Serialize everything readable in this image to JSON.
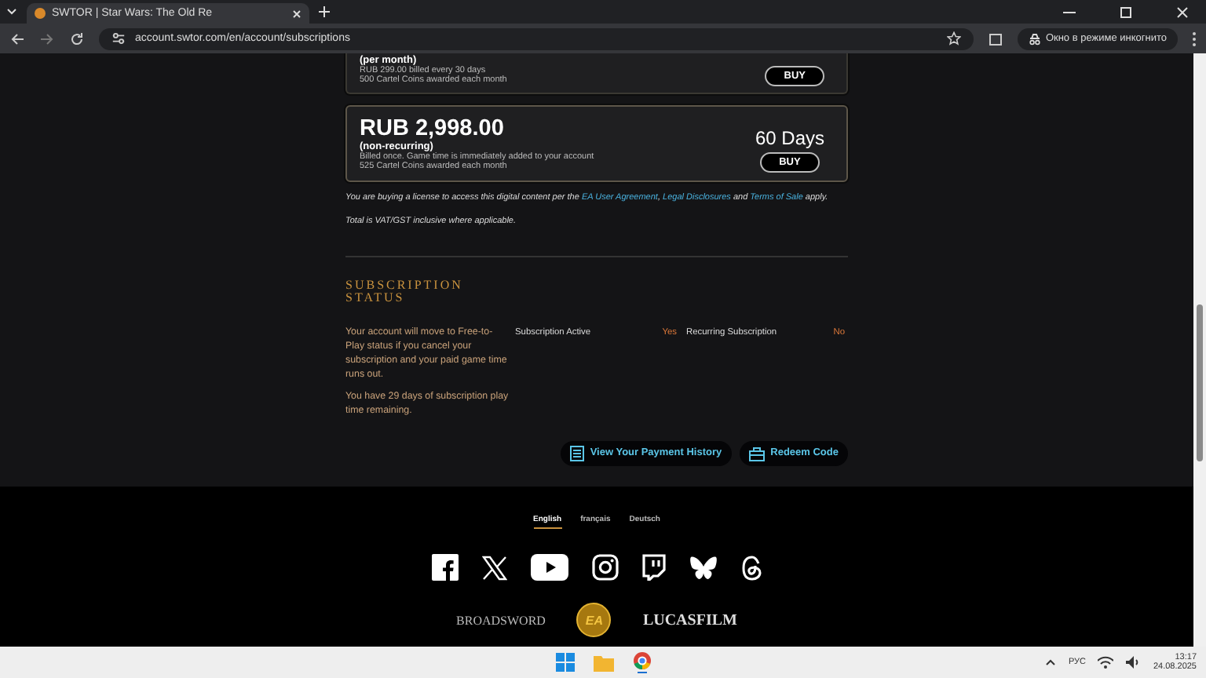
{
  "browser": {
    "tab_title": "SWTOR | Star Wars: The Old Re",
    "url": "account.swtor.com/en/account/subscriptions",
    "incognito_label": "Окно в режиме инкогнито"
  },
  "plans": [
    {
      "kind": "partial",
      "term": "(per month)",
      "details": [
        "RUB 299.00 billed every 30 days",
        "500 Cartel Coins awarded each month"
      ],
      "button": "BUY"
    },
    {
      "kind": "full",
      "price": "RUB 2,998.00",
      "term": "(non-recurring)",
      "details": [
        "Billed once. Game time is immediately added to your account",
        "525 Cartel Coins awarded each month"
      ],
      "days": "60 Days",
      "button": "BUY"
    }
  ],
  "legal": {
    "before": "You are buying a license to access this digital content per the",
    "links": [
      "EA User Agreement",
      ",",
      "Legal Disclosures",
      "and",
      "Terms of Sale"
    ],
    "after": "apply.",
    "tax": "Total is VAT/GST inclusive where applicable."
  },
  "subscription_status": {
    "heading": "SUBSCRIPTION STATUS",
    "paragraphs": [
      "Your account will move to Free-to-Play status if you cancel your subscription and your paid game time runs out.",
      "You have 29 days of subscription play time remaining."
    ],
    "fields": [
      {
        "label": "Subscription Active",
        "value": "Yes"
      },
      {
        "label": "Recurring Subscription",
        "value": "No"
      }
    ],
    "buttons": [
      {
        "kind": "history",
        "label": "View Your Payment History"
      },
      {
        "kind": "redeem",
        "label": "Redeem Code"
      }
    ]
  },
  "footer": {
    "languages": [
      {
        "label": "English",
        "selected": true
      },
      {
        "label": "français",
        "selected": false
      },
      {
        "label": "Deutsch",
        "selected": false
      }
    ],
    "logos": [
      "BROADSWORD",
      "EA",
      "LUCASFILM"
    ]
  },
  "taskbar": {
    "language": "РУС",
    "time": "13:17",
    "date": "24.08.2025"
  }
}
